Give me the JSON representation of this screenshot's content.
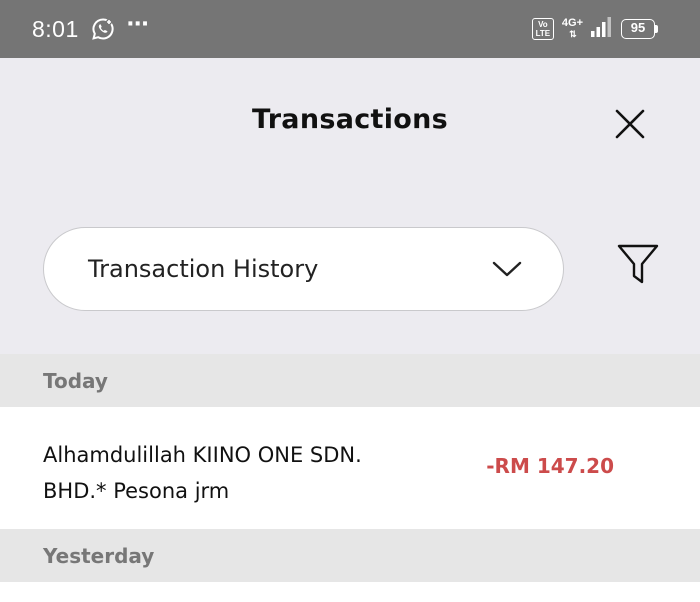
{
  "status_bar": {
    "time": "8:01",
    "notification_icon": "whatsapp-icon",
    "overflow": "⋯",
    "volte": "Vo LTE",
    "network": "4G+",
    "battery": "95"
  },
  "header": {
    "title": "Transactions",
    "close_icon": "close-icon"
  },
  "filter": {
    "dropdown_value": "Transaction History",
    "dropdown_icon": "chevron-down-icon",
    "filter_icon": "filter-icon"
  },
  "sections": [
    {
      "label": "Today",
      "transactions": [
        {
          "description": "Alhamdulillah KIINO ONE SDN. BHD.* Pesona jrm",
          "amount": "-RM 147.20"
        }
      ]
    },
    {
      "label": "Yesterday",
      "transactions": []
    }
  ],
  "colors": {
    "status_bar_bg": "#757575",
    "page_bg": "#ecebf0",
    "section_bg": "#e6e6e6",
    "debit_amount": "#cc4b4b"
  }
}
